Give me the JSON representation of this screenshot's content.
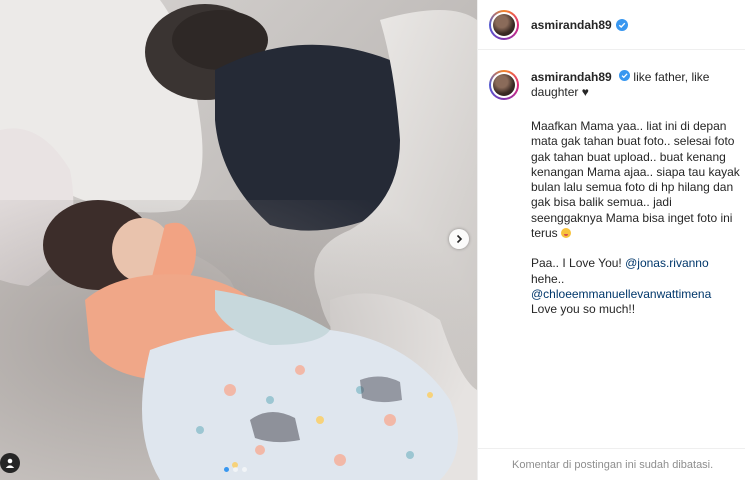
{
  "post": {
    "photo_alt": "",
    "carousel": {
      "slides": 3,
      "active": 0
    }
  },
  "header": {
    "username": "asmirandah89",
    "verified_icon": "verified-badge-icon"
  },
  "caption": {
    "username": "asmirandah89",
    "headline": "like father, like daughter",
    "headline_symbol": "♥",
    "paragraph1": "Maafkan Mama yaa.. liat ini di depan mata gak tahan buat foto.. selesai foto gak tahan buat upload.. buat kenang kenangan Mama ajaa.. siapa tau kayak bulan lalu semua foto di hp hilang dan gak bisa balik semua.. jadi seenggaknya Mama bisa inget foto ini terus",
    "paragraph2_prefix": "Paa.. I Love You!",
    "mention1": "@jonas.rivanno",
    "paragraph2_mid": "hehe..",
    "mention2": "@chloeemmanuellevanwattimena",
    "paragraph2_suffix": "Love you so much!!"
  },
  "footer": {
    "comments_disabled": "Komentar di postingan ini sudah dibatasi."
  },
  "colors": {
    "verified": "#3897f0",
    "mention": "#00376b",
    "muted": "#8e8e8e"
  }
}
